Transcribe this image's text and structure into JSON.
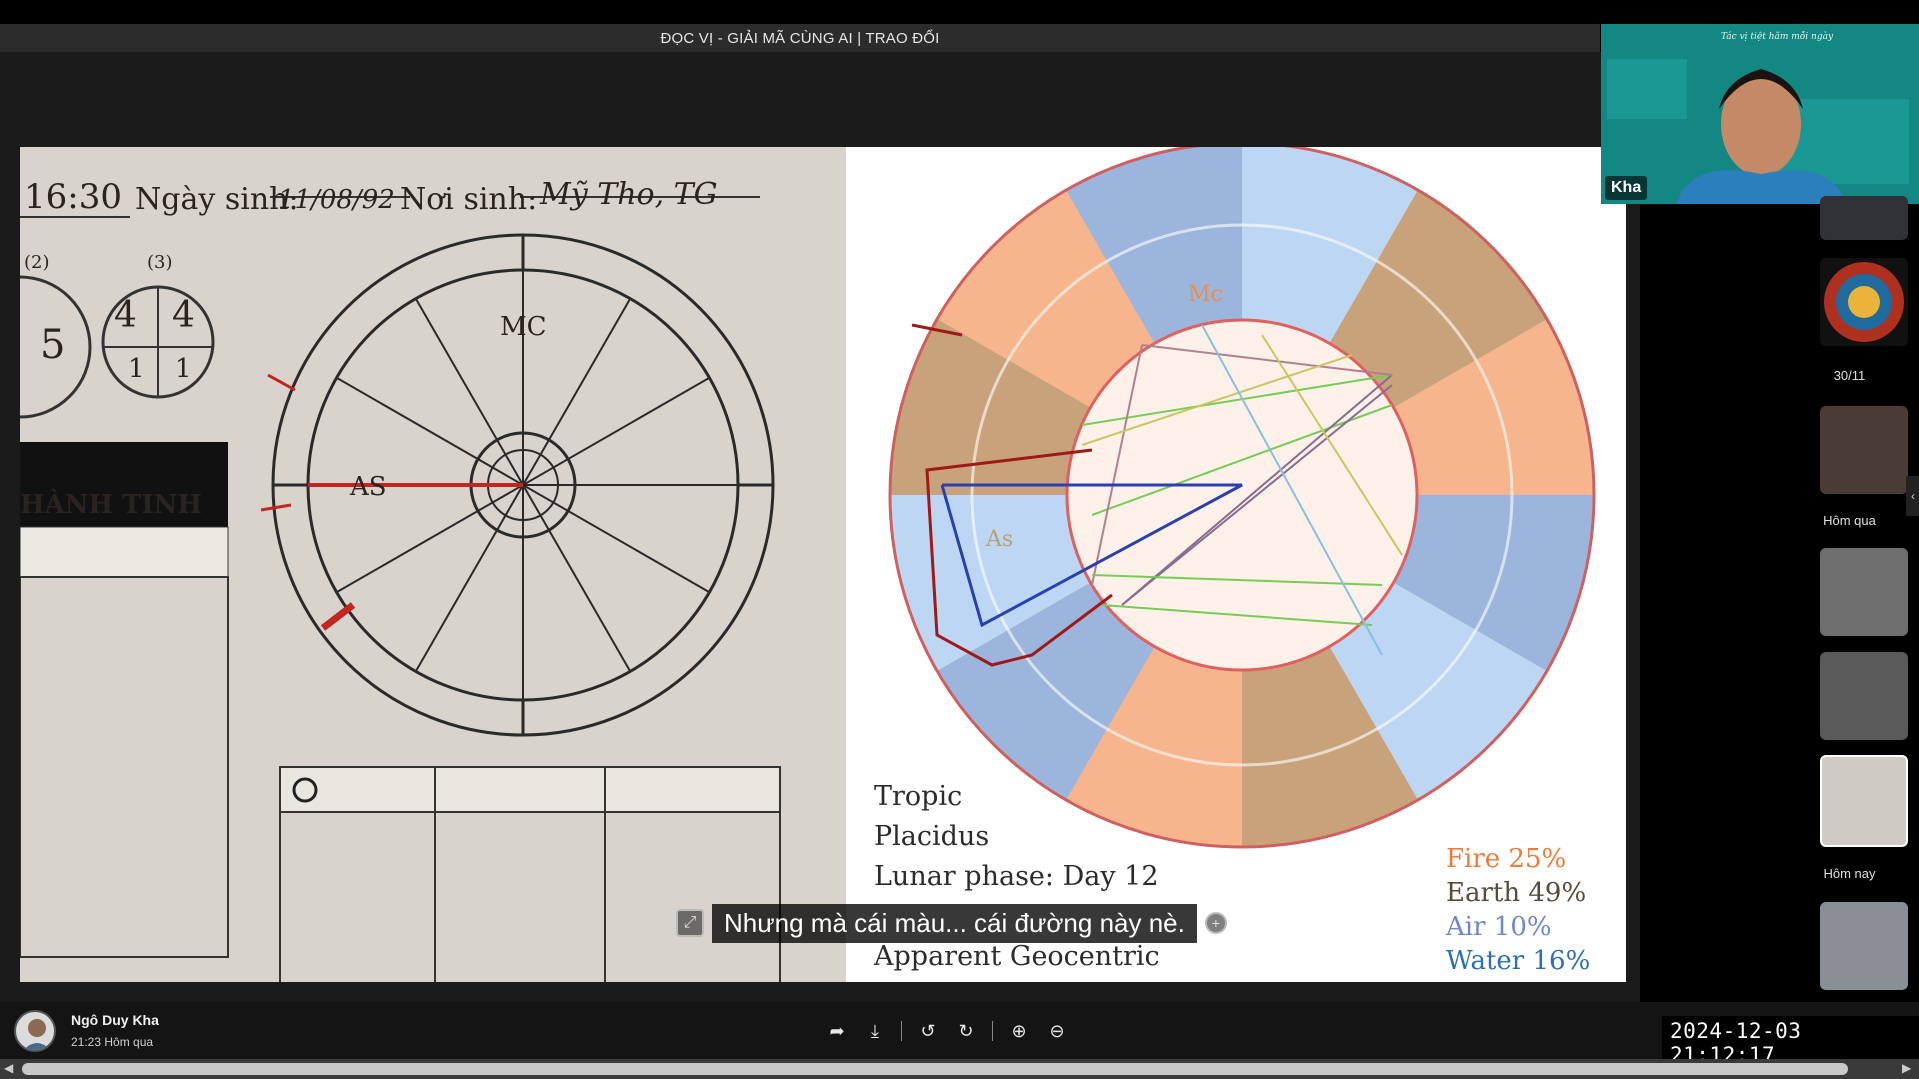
{
  "title": "ĐỌC VỊ - GIẢI MÃ CÙNG AI | TRAO ĐỔI",
  "webcam": {
    "name": "Kha",
    "slide_heading": "Tác vị tiệt hãm mỗi ngày"
  },
  "notes_photo": {
    "header_time": "16:30",
    "birth_label": "Ngày sinh:",
    "birth_value": "11/08/92",
    "place_label": "Nơi sinh:",
    "place_value": "Mỹ Tho, TG",
    "box_labels": [
      "(2)",
      "(3)"
    ],
    "box_numbers": [
      "5",
      "4",
      "4",
      "1",
      "1"
    ],
    "section_header": "HÀNH TINH",
    "chart_mark_mc": "MC",
    "chart_mark_as": "AS"
  },
  "chart_image": {
    "info_lines": [
      "Tropic",
      "Placidus",
      "Lunar phase: Day 12",
      "Apparent Geocentric"
    ],
    "elements": [
      {
        "label": "Fire 25%",
        "color": "#f07a3a"
      },
      {
        "label": "Earth 49%",
        "color": "#5a4a3a"
      },
      {
        "label": "Air 10%",
        "color": "#6f86d0"
      },
      {
        "label": "Water 16%",
        "color": "#2b6fb4"
      }
    ],
    "mc_label": "Mc",
    "as_label": "As"
  },
  "subtitle": "Nhưng mà cái màu... cái đường này nè.",
  "sidebar": {
    "date_labels": [
      "30/11",
      "Hôm qua",
      "Hôm nay"
    ]
  },
  "user": {
    "name": "Ngô Duy Kha",
    "time": "21:23 Hôm qua"
  },
  "timestamp": "2024-12-03 21:12:17"
}
